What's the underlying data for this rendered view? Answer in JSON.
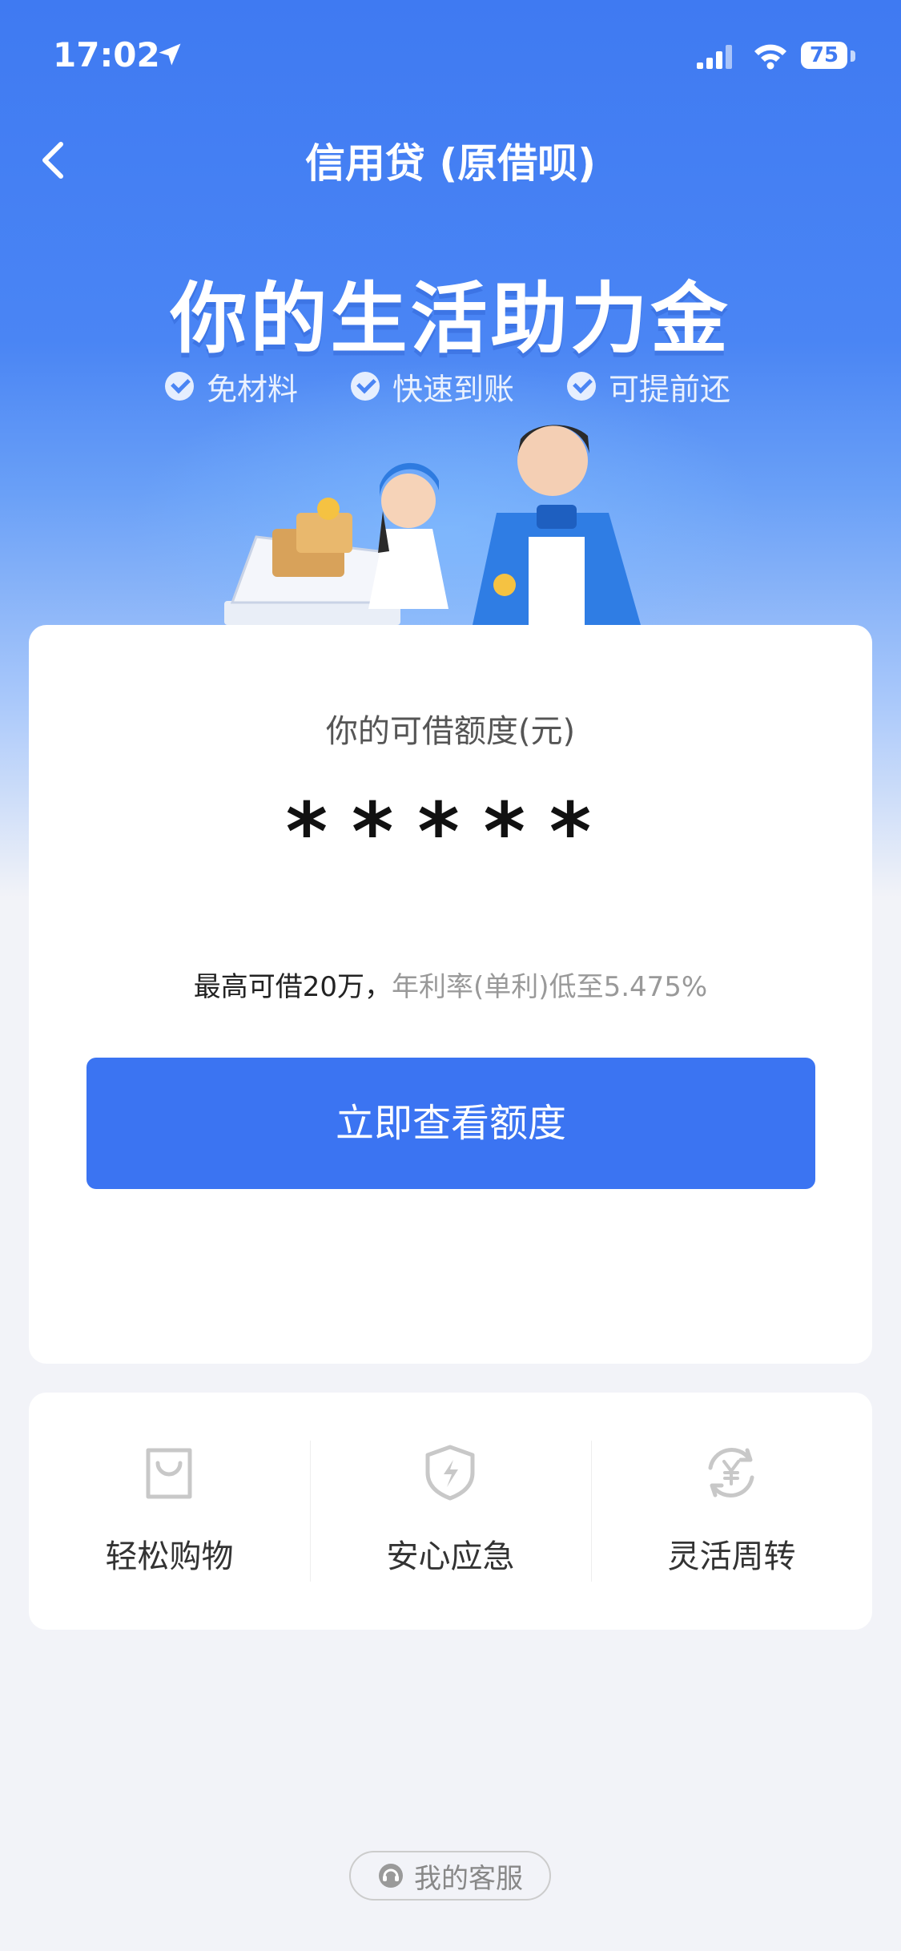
{
  "status_bar": {
    "time": "17:02",
    "battery": "75"
  },
  "nav": {
    "title": "信用贷 (原借呗)"
  },
  "hero": {
    "title": "你的生活助力金",
    "features": [
      "免材料",
      "快速到账",
      "可提前还"
    ]
  },
  "quota": {
    "label": "你的可借额度(元)",
    "masked_amount": "*****",
    "desc_max": "最高可借20万，",
    "desc_rate": "年利率(单利)低至5.475%",
    "cta": "立即查看额度"
  },
  "benefits": [
    "轻松购物",
    "安心应急",
    "灵活周转"
  ],
  "customer_service": {
    "label": "我的客服"
  },
  "colors": {
    "primary": "#3b74f2",
    "hero_top": "#3f7af2",
    "page_bg": "#f2f3f8"
  }
}
